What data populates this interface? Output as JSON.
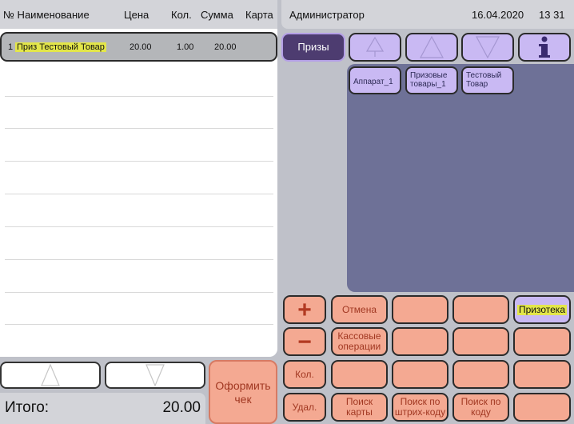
{
  "receipt": {
    "columns": [
      "№ Наименование",
      "Цена",
      "Кол.",
      "Сумма",
      "Карта"
    ],
    "rows": [
      {
        "num": "1",
        "name": "Приз Тестовый Товар",
        "price": "20.00",
        "qty": "1.00",
        "sum": "20.00"
      }
    ]
  },
  "total": {
    "label": "Итого:",
    "value": "20.00"
  },
  "checkout_label": "Оформить чек",
  "header": {
    "user": "Администратор",
    "date": "16.04.2020",
    "time": "13 31"
  },
  "group_button": "Призы",
  "items": [
    {
      "label": "Аппарат_1"
    },
    {
      "label": "Призовые товары_1"
    },
    {
      "label": "Тестовый Товар"
    }
  ],
  "keypad": {
    "plus": "+",
    "minus": "−",
    "cancel": "Отмена",
    "prize_store": "Призотека",
    "cash_ops": "Кассовые операции",
    "qty": "Кол.",
    "delete": "Удал.",
    "search_card": "Поиск карты",
    "search_barcode": "Поиск по штрих-коду",
    "search_code": "Поиск по коду"
  },
  "icons": {
    "info": "info-icon",
    "up": "arrow-up-icon",
    "down": "arrow-down-icon"
  },
  "colors": {
    "accent_purple": "#c9b9f3",
    "key_salmon": "#f4a992",
    "items_bg": "#6e7197",
    "group_active": "#4d3c70",
    "highlight": "#e3e64a"
  }
}
